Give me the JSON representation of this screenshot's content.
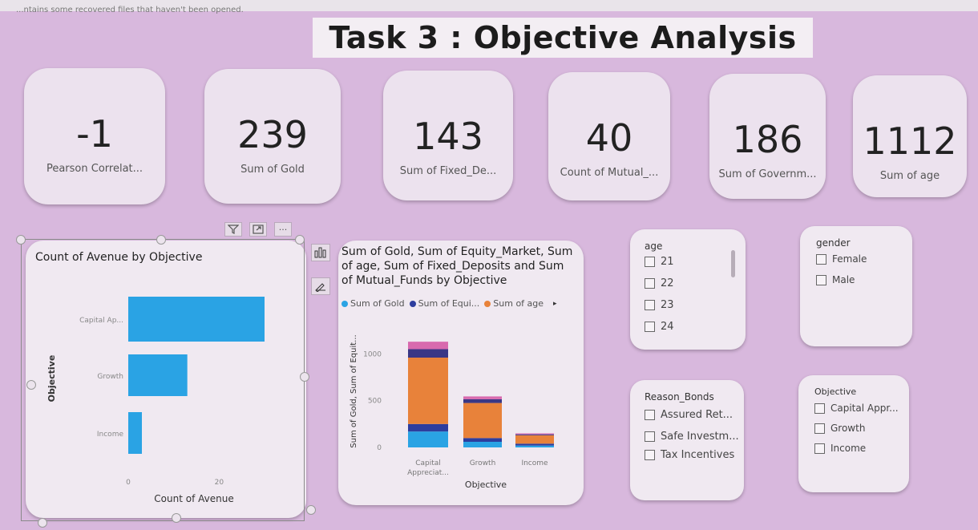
{
  "topbar": {
    "text": "...ntains some recovered files that haven't been opened."
  },
  "title": "Task  3 : Objective Analysis",
  "cards": [
    {
      "value": "-1",
      "label": "Pearson  Correlat..."
    },
    {
      "value": "239",
      "label": "Sum of Gold"
    },
    {
      "value": "143",
      "label": "Sum of Fixed_De..."
    },
    {
      "value": "40",
      "label": "Count of Mutual_..."
    },
    {
      "value": "186",
      "label": "Sum of Governm..."
    },
    {
      "value": "1112",
      "label": "Sum of age"
    }
  ],
  "visual_toolbar": {
    "filter_icon": "filter-icon",
    "focus_icon": "focus-mode-icon",
    "more": "···"
  },
  "bar_chart": {
    "title": "Count of Avenue by Objective",
    "chart_data": {
      "type": "bar",
      "orientation": "horizontal",
      "title": "Count of Avenue by Objective",
      "categories": [
        "Capital Ap...",
        "Growth",
        "Income"
      ],
      "values": [
        30,
        13,
        3
      ],
      "xlabel": "Count of Avenue",
      "ylabel": "Objective",
      "xticks": [
        "0",
        "20"
      ],
      "xlim": [
        0,
        30
      ],
      "color": "#2aa3e4"
    }
  },
  "stacked_chart": {
    "title_lines": [
      "Sum of Gold, Sum of Equity_Market, Sum",
      "of age, Sum of Fixed_Deposits and Sum",
      "of Mutual_Funds by Objective"
    ],
    "legend": [
      {
        "label": "Sum of Gold",
        "color": "#2aa3e4"
      },
      {
        "label": "Sum of Equi...",
        "color": "#2d3d9e"
      },
      {
        "label": "Sum of age",
        "color": "#e8823a"
      }
    ],
    "legend_more": "▸",
    "chart_data": {
      "type": "bar",
      "stacked": true,
      "categories": [
        "Capital Appreciat...",
        "Growth",
        "Income"
      ],
      "category_labels": [
        [
          "Capital",
          "Appreciat..."
        ],
        [
          "Growth"
        ],
        [
          "Income"
        ]
      ],
      "series": [
        {
          "name": "Sum of Gold",
          "color": "#2aa3e4",
          "values": [
            170,
            60,
            20
          ]
        },
        {
          "name": "Sum of Equi...",
          "color": "#2d3d9e",
          "values": [
            80,
            40,
            20
          ]
        },
        {
          "name": "Sum of age",
          "color": "#e8823a",
          "values": [
            710,
            375,
            90
          ]
        },
        {
          "color": "#3a3785",
          "values": [
            90,
            40,
            10
          ]
        },
        {
          "color": "#d86aae",
          "values": [
            80,
            30,
            10
          ]
        }
      ],
      "xlabel": "Objective",
      "ylabel": "Sum of Gold, Sum of Equit...",
      "yticks": [
        0,
        500,
        1000
      ],
      "ylim": [
        0,
        1200
      ]
    }
  },
  "slicers": {
    "age": {
      "title": "age",
      "items": [
        "21",
        "22",
        "23",
        "24"
      ]
    },
    "gender": {
      "title": "gender",
      "items": [
        "Female",
        "Male"
      ]
    },
    "reason_bonds": {
      "title": "Reason_Bonds",
      "items": [
        "Assured Ret...",
        "Safe Investm...",
        "Tax Incentives"
      ]
    },
    "objective": {
      "title": "Objective",
      "items": [
        "Capital Appr...",
        "Growth",
        "Income"
      ]
    }
  }
}
